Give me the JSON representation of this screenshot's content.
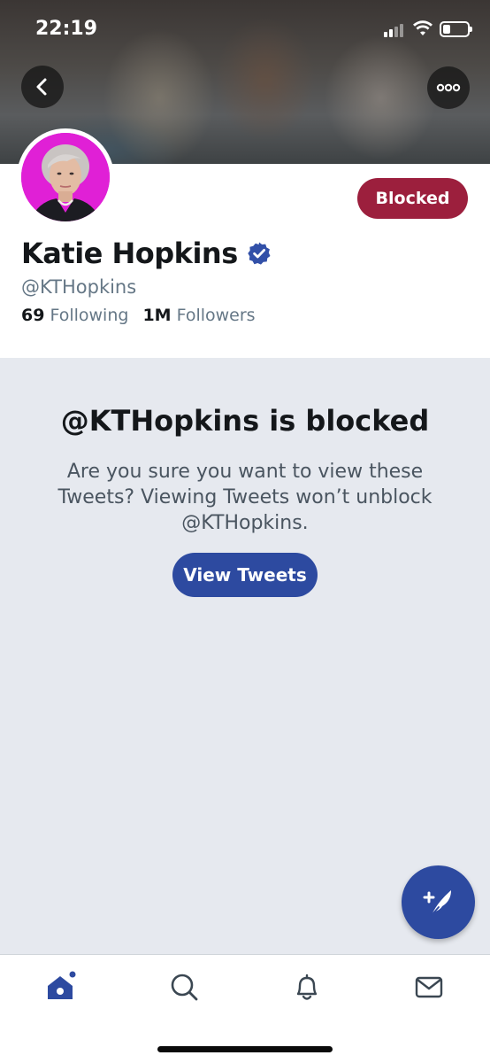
{
  "status_bar": {
    "time": "22:19"
  },
  "profile": {
    "name": "Katie Hopkins",
    "handle": "@KTHopkins",
    "verified": true,
    "blocked_label": "Blocked",
    "following_count": "69",
    "following_label": "Following",
    "followers_count": "1M",
    "followers_label": "Followers"
  },
  "blocked_panel": {
    "title": "@KTHopkins is blocked",
    "message": "Are you sure you want to view these Tweets? Viewing Tweets won’t unblock @KTHopkins.",
    "button_label": "View Tweets"
  },
  "icons": {
    "back": "chevron-left-icon",
    "more": "more-horizontal-icon",
    "verified": "verified-badge-icon",
    "compose": "compose-tweet-icon",
    "tabs": [
      "home-icon",
      "search-icon",
      "notifications-icon",
      "messages-icon"
    ]
  },
  "colors": {
    "accent": "#2d4aa0",
    "blocked": "#9c1f3d",
    "verified": "#3250a8",
    "panel_bg": "#e6e9ef",
    "avatar_bg": "#e020d6"
  }
}
